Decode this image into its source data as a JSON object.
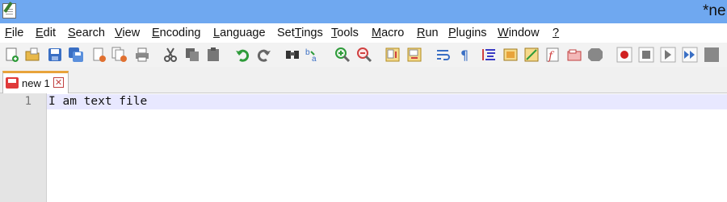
{
  "window": {
    "title": "*ne"
  },
  "menu": [
    {
      "accel": "F",
      "rest": "ile"
    },
    {
      "accel": "E",
      "rest": "dit"
    },
    {
      "accel": "S",
      "rest": "earch"
    },
    {
      "accel": "V",
      "rest": "iew"
    },
    {
      "accel": "E",
      "rest": "ncoding",
      "pre": ""
    },
    {
      "accel": "L",
      "rest": "anguage"
    },
    {
      "accel": "T",
      "rest": "ings",
      "pre": "Set"
    },
    {
      "accel": "T",
      "rest": "ools"
    },
    {
      "accel": "M",
      "rest": "acro"
    },
    {
      "accel": "R",
      "rest": "un"
    },
    {
      "accel": "P",
      "rest": "lugins"
    },
    {
      "accel": "W",
      "rest": "indow"
    },
    {
      "accel": "?",
      "rest": ""
    }
  ],
  "toolbar": {
    "icons": [
      "new-file-icon",
      "open-folder-icon",
      "save-icon",
      "save-all-icon",
      "close-icon",
      "close-all-icon",
      "print-icon",
      "cut-icon",
      "copy-icon",
      "paste-icon",
      "undo-icon",
      "redo-icon",
      "find-icon",
      "replace-icon",
      "zoom-in-icon",
      "zoom-out-icon",
      "sync-vertical-icon",
      "sync-horizontal-icon",
      "word-wrap-icon",
      "show-all-chars-icon",
      "indent-guide-icon",
      "folder-as-workspace-icon",
      "document-map-icon",
      "function-list-icon",
      "clipboard-history-icon",
      "monitoring-icon",
      "record-macro-icon",
      "stop-record-icon",
      "playback-macro-icon",
      "run-macro-multiple-icon",
      "save-macro-icon"
    ]
  },
  "tab": {
    "label": "new 1",
    "close": "✕"
  },
  "editor": {
    "line_number": "1",
    "line_text": "I am text file"
  }
}
